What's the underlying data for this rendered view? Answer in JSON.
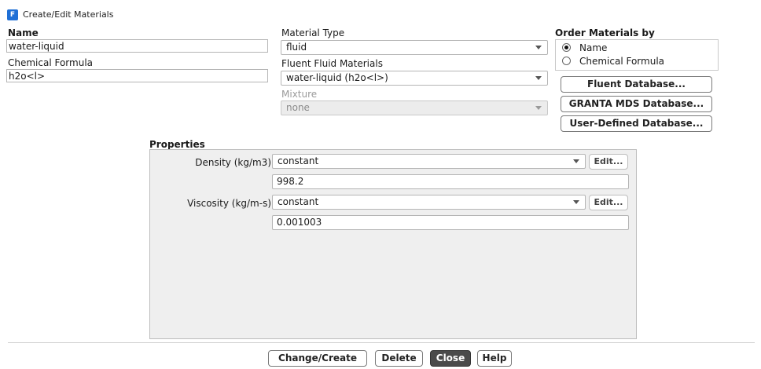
{
  "window": {
    "title": "Create/Edit Materials",
    "icon_letter": "F"
  },
  "name": {
    "label": "Name",
    "value": "water-liquid"
  },
  "chemical_formula": {
    "label": "Chemical Formula",
    "value": "h2o<l>"
  },
  "material_type": {
    "label": "Material Type",
    "value": "fluid"
  },
  "fluent_fluid_materials": {
    "label": "Fluent Fluid Materials",
    "value": "water-liquid (h2o<l>)"
  },
  "mixture": {
    "label": "Mixture",
    "value": "none"
  },
  "order_by": {
    "label": "Order Materials by",
    "options": [
      {
        "label": "Name",
        "selected": true
      },
      {
        "label": "Chemical Formula",
        "selected": false
      }
    ]
  },
  "databases": {
    "fluent": "Fluent Database...",
    "granta": "GRANTA MDS Database...",
    "user_defined": "User-Defined Database..."
  },
  "properties": {
    "label": "Properties",
    "density": {
      "label": "Density (kg/m3)",
      "method": "constant",
      "value": "998.2",
      "edit": "Edit..."
    },
    "viscosity": {
      "label": "Viscosity (kg/m-s)",
      "method": "constant",
      "value": "0.001003",
      "edit": "Edit..."
    }
  },
  "footer": {
    "change_create": "Change/Create",
    "delete": "Delete",
    "close": "Close",
    "help": "Help"
  }
}
